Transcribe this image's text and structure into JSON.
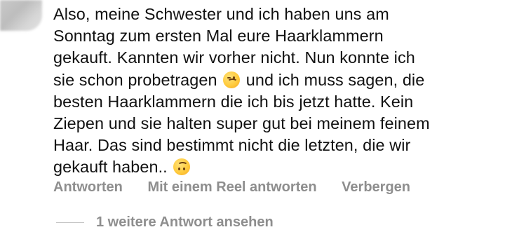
{
  "comment": {
    "lines": [
      "Also, meine Schwester und ich haben uns am",
      "Sonntag zum ersten Mal eure Haarklammern",
      "gekauft. Kannten wir vorher nicht. Nun konnte ich",
      {
        "before": "sie schon probetragen",
        "after": "und ich muss sagen, die"
      },
      "besten Haarklammern die ich bis jetzt hatte. Kein",
      "Ziepen und sie halten super gut bei meinem feinem",
      "Haar. Das sind bestimmt nicht die letzten, die wir",
      {
        "before": "gekauft haben..",
        "after": ""
      }
    ],
    "emojis": [
      "winking-face-emoji",
      "upside-down-face-emoji"
    ]
  },
  "actions": {
    "reply": "Antworten",
    "reply_reel": "Mit einem Reel antworten",
    "hide": "Verbergen"
  },
  "more_replies": "1 weitere Antwort ansehen"
}
